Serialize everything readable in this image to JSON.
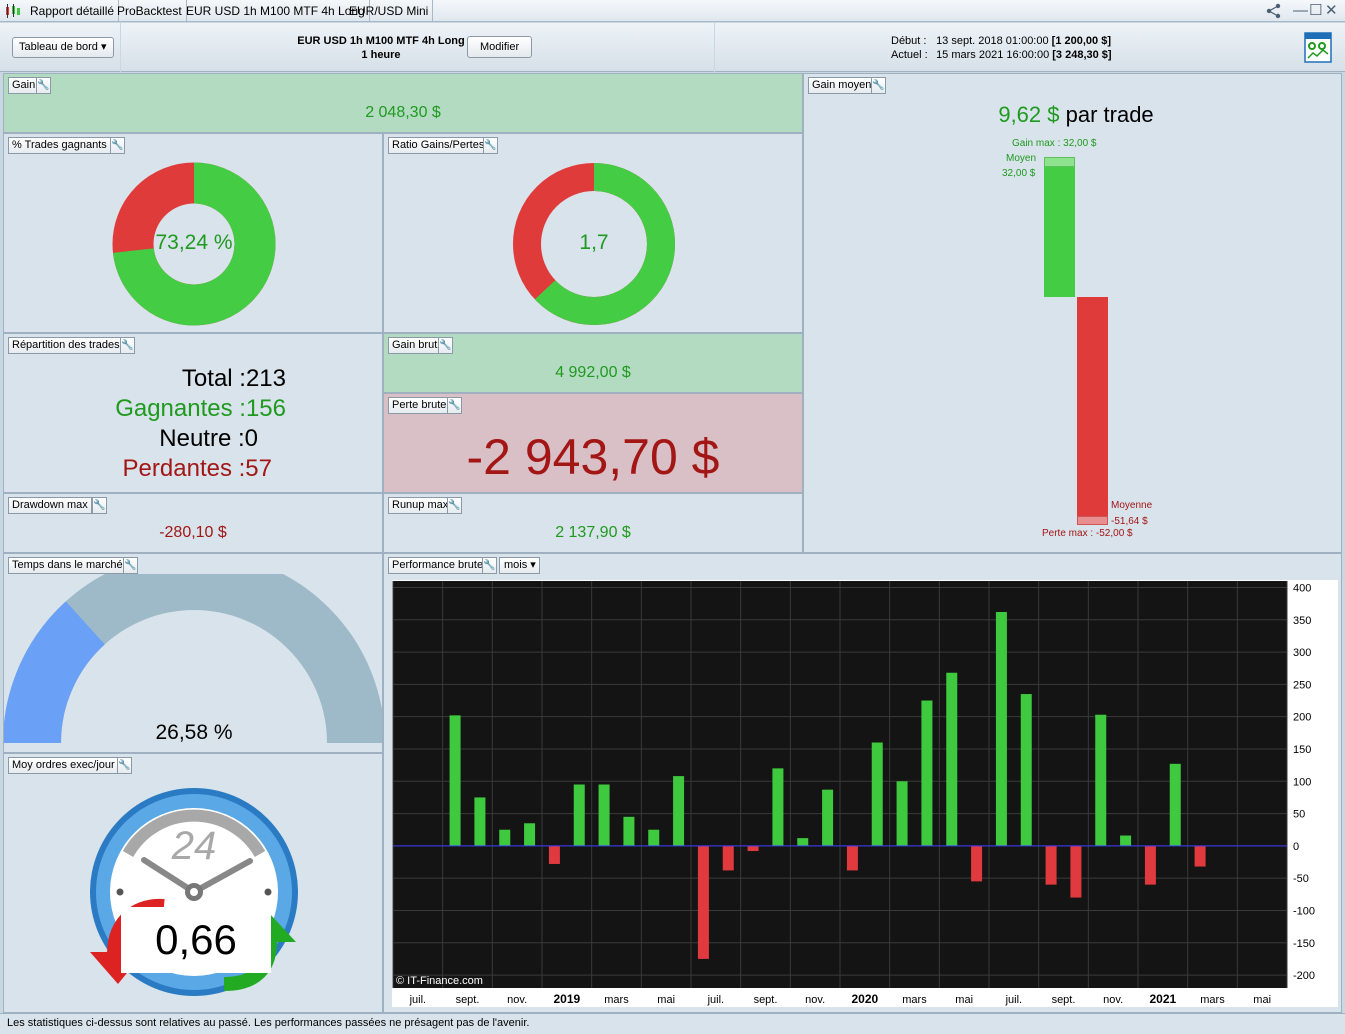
{
  "tabbar": {
    "tabs": [
      {
        "label": "Rapport détaillé"
      },
      {
        "label": "ProBacktest"
      },
      {
        "label": "EUR USD 1h M100 MTF 4h Long"
      },
      {
        "label": "EUR/USD Mini"
      }
    ],
    "controls": {
      "share": "⋔",
      "minimize": "—",
      "maximize": "☐",
      "close": "✕"
    }
  },
  "header": {
    "view_select": "Tableau de bord",
    "strategy_name": "EUR USD 1h M100 MTF 4h Long",
    "timeframe": "1 heure",
    "modify_button": "Modifier",
    "start_label": "Début :",
    "start_date": "13 sept. 2018 01:00:00",
    "start_value": "[1 200,00 $]",
    "current_label": "Actuel :",
    "current_date": "15 mars 2021 16:00:00",
    "current_value": "[3 248,30 $]",
    "report_icon": "report-icon"
  },
  "gain": {
    "title": "Gain",
    "value": "2 048,30 $"
  },
  "win_trades": {
    "title": "% Trades gagnants",
    "label": "73,24 %",
    "fraction": 0.7324
  },
  "ratio": {
    "title": "Ratio Gains/Pertes",
    "label": "1,7",
    "fraction": 0.63
  },
  "repartition": {
    "title": "Répartition des trades",
    "total_label": "Total : ",
    "total_value": "213",
    "win_label": "Gagnantes : ",
    "win_value": "156",
    "neutral_label": "Neutre : ",
    "neutral_value": "0",
    "loss_label": "Perdantes : ",
    "loss_value": "57"
  },
  "gross_gain": {
    "title": "Gain brut",
    "value": "4 992,00 $"
  },
  "gross_loss": {
    "title": "Perte brute",
    "value": "-2 943,70 $"
  },
  "drawdown": {
    "title": "Drawdown max",
    "value": "-280,10 $"
  },
  "runup": {
    "title": "Runup max",
    "value": "2 137,90 $"
  },
  "avg_gain": {
    "title": "Gain moyen",
    "value": "9,62 $",
    "suffix": " par trade",
    "gain_max_label": "Gain max : 32,00 $",
    "avg_win_label1": "Moyen",
    "avg_win_label2": "32,00 $",
    "avg_loss_label1": "Moyenne",
    "avg_loss_label2": "-51,64 $",
    "loss_max_label": "Perte max : -52,00 $",
    "gain_max": 32.0,
    "avg_win": 32.0,
    "avg_loss": -51.64,
    "loss_max": -52.0
  },
  "market_time": {
    "title": "Temps dans le marché",
    "label": "26,58 %",
    "fraction": 0.2658
  },
  "orders": {
    "title": "Moy ordres exec/jour",
    "dial_value": "24",
    "value": "0,66"
  },
  "performance": {
    "title": "Performance brute",
    "period": "mois",
    "watermark": "© IT-Finance.com"
  },
  "chart_data": {
    "type": "bar",
    "categories": [
      "2018-07",
      "2018-08",
      "2018-09",
      "2018-10",
      "2018-11",
      "2018-12",
      "2019-01",
      "2019-02",
      "2019-03",
      "2019-04",
      "2019-05",
      "2019-06",
      "2019-07",
      "2019-08",
      "2019-09",
      "2019-10",
      "2019-11",
      "2019-12",
      "2020-01",
      "2020-02",
      "2020-03",
      "2020-04",
      "2020-05",
      "2020-06",
      "2020-07",
      "2020-08",
      "2020-09",
      "2020-10",
      "2020-11",
      "2020-12",
      "2021-01",
      "2021-02",
      "2021-03",
      "2021-04",
      "2021-05",
      "2021-06"
    ],
    "values": [
      0,
      0,
      202,
      75,
      25,
      35,
      -28,
      95,
      95,
      45,
      25,
      108,
      -175,
      -38,
      -8,
      120,
      12,
      87,
      -38,
      160,
      100,
      225,
      268,
      -55,
      362,
      235,
      -60,
      -80,
      203,
      16,
      -60,
      127,
      -32,
      0,
      0,
      0
    ],
    "ylim": [
      -220,
      410
    ],
    "yticks": [
      400,
      350,
      300,
      250,
      200,
      150,
      100,
      50,
      0,
      -50,
      -100,
      -150,
      -200
    ],
    "xtick_labels": [
      {
        "label": "juil.",
        "bold": false
      },
      {
        "label": "sept.",
        "bold": false
      },
      {
        "label": "nov.",
        "bold": false
      },
      {
        "label": "2019",
        "bold": true
      },
      {
        "label": "mars",
        "bold": false
      },
      {
        "label": "mai",
        "bold": false
      },
      {
        "label": "juil.",
        "bold": false
      },
      {
        "label": "sept.",
        "bold": false
      },
      {
        "label": "nov.",
        "bold": false
      },
      {
        "label": "2020",
        "bold": true
      },
      {
        "label": "mars",
        "bold": false
      },
      {
        "label": "mai",
        "bold": false
      },
      {
        "label": "juil.",
        "bold": false
      },
      {
        "label": "sept.",
        "bold": false
      },
      {
        "label": "nov.",
        "bold": false
      },
      {
        "label": "2021",
        "bold": true
      },
      {
        "label": "mars",
        "bold": false
      },
      {
        "label": "mai",
        "bold": false
      }
    ],
    "grid": true,
    "colors": {
      "positive": "#3ec93e",
      "negative": "#e0393e",
      "background": "#141414",
      "zero_line": "#3a3aff"
    }
  },
  "footer": {
    "text": "Les statistiques ci-dessus sont relatives au passé. Les performances passées ne présagent pas de l'avenir."
  },
  "colors": {
    "green_text": "#1f9a1f",
    "red_text": "#a31616",
    "win": "#44cc44",
    "loss": "#e03b3b",
    "panel": "#d8e3eb",
    "gauge_fill": "#6aa0f5",
    "gauge_track": "#9ebac9"
  }
}
